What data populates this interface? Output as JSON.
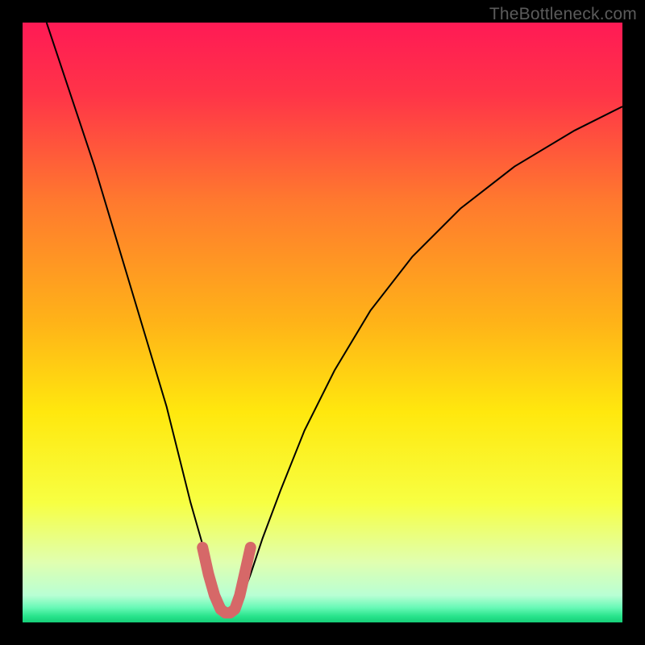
{
  "watermark": "TheBottleneck.com",
  "chart_data": {
    "type": "line",
    "title": "",
    "xlabel": "",
    "ylabel": "",
    "xlim": [
      0,
      100
    ],
    "ylim": [
      0,
      100
    ],
    "background_gradient": {
      "orientation": "vertical",
      "stops": [
        {
          "offset": 0.0,
          "color": "#ff1a55"
        },
        {
          "offset": 0.12,
          "color": "#ff3448"
        },
        {
          "offset": 0.3,
          "color": "#ff7a2e"
        },
        {
          "offset": 0.5,
          "color": "#ffb318"
        },
        {
          "offset": 0.65,
          "color": "#ffe80e"
        },
        {
          "offset": 0.8,
          "color": "#f7ff42"
        },
        {
          "offset": 0.9,
          "color": "#e0ffb0"
        },
        {
          "offset": 0.955,
          "color": "#b8ffd4"
        },
        {
          "offset": 0.975,
          "color": "#69f9b7"
        },
        {
          "offset": 0.99,
          "color": "#27e38b"
        },
        {
          "offset": 1.0,
          "color": "#16cf78"
        }
      ]
    },
    "series": [
      {
        "name": "bottleneck-curve",
        "color": "#000000",
        "stroke_width": 2,
        "x": [
          4,
          8,
          12,
          15,
          18,
          21,
          24,
          26,
          28,
          30,
          31.5,
          33,
          34,
          35,
          36.5,
          38,
          40,
          43,
          47,
          52,
          58,
          65,
          73,
          82,
          92,
          100
        ],
        "y": [
          100,
          88,
          76,
          66,
          56,
          46,
          36,
          28,
          20,
          13,
          8,
          4,
          2,
          2,
          4,
          8,
          14,
          22,
          32,
          42,
          52,
          61,
          69,
          76,
          82,
          86
        ]
      }
    ],
    "highlight": {
      "name": "solution-band",
      "color": "#d66868",
      "stroke_width": 14,
      "x": [
        30,
        31,
        32,
        33,
        33.8,
        34.6,
        35.4,
        36.2,
        37,
        38
      ],
      "y": [
        12.5,
        8,
        4.5,
        2.2,
        1.6,
        1.6,
        2.2,
        4.5,
        8,
        12.5
      ]
    }
  }
}
